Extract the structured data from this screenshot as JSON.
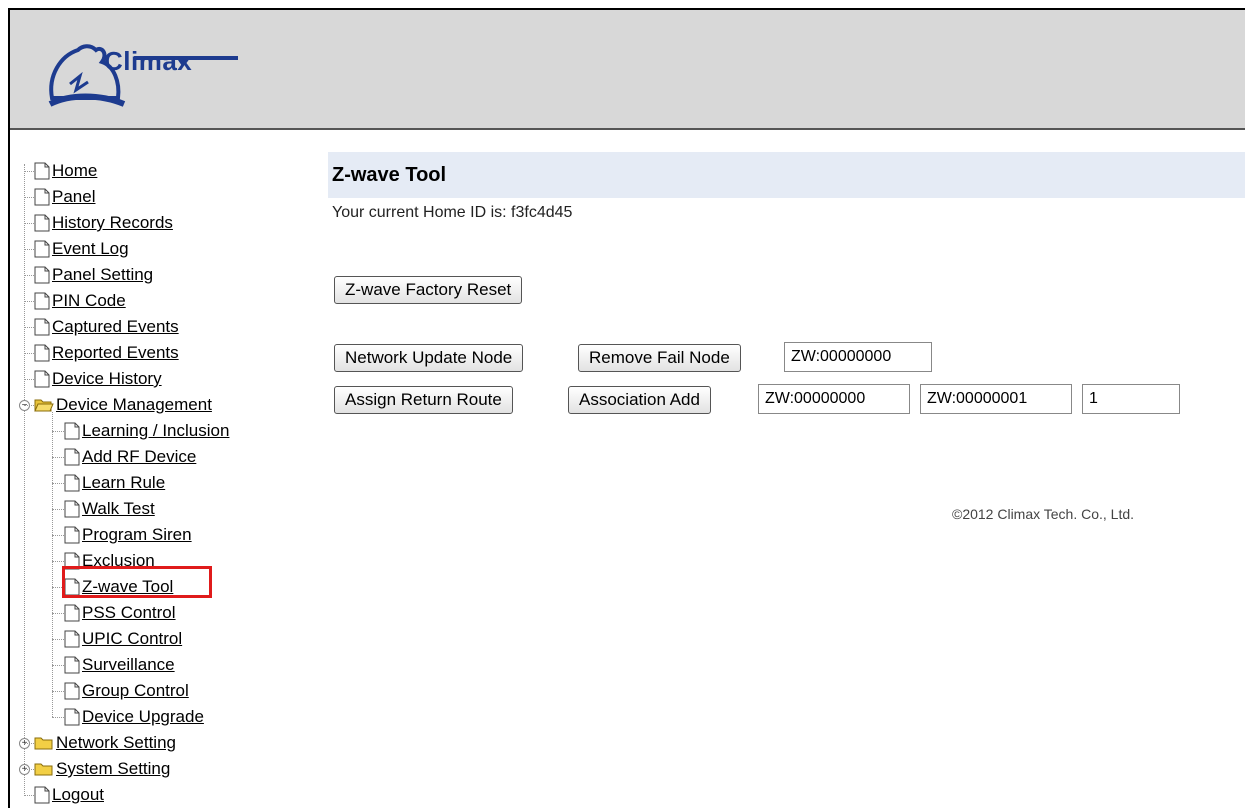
{
  "header": {
    "logo_text": "Climax"
  },
  "sidebar": {
    "items": [
      {
        "label": "Home"
      },
      {
        "label": "Panel"
      },
      {
        "label": "History Records"
      },
      {
        "label": "Event Log"
      },
      {
        "label": "Panel Setting"
      },
      {
        "label": "PIN Code"
      },
      {
        "label": "Captured Events"
      },
      {
        "label": "Reported Events"
      },
      {
        "label": "Device History"
      },
      {
        "label": "Device Management",
        "expanded": true,
        "children": [
          {
            "label": "Learning / Inclusion"
          },
          {
            "label": "Add RF Device"
          },
          {
            "label": "Learn Rule"
          },
          {
            "label": "Walk Test"
          },
          {
            "label": "Program Siren"
          },
          {
            "label": "Exclusion"
          },
          {
            "label": "Z-wave Tool",
            "selected": true
          },
          {
            "label": "PSS Control"
          },
          {
            "label": "UPIC Control"
          },
          {
            "label": "Surveillance"
          },
          {
            "label": "Group Control"
          },
          {
            "label": "Device Upgrade"
          }
        ]
      },
      {
        "label": "Network Setting",
        "expanded": false
      },
      {
        "label": "System Setting",
        "expanded": false
      },
      {
        "label": "Logout"
      }
    ],
    "highlight_color": "#e01b1b"
  },
  "main": {
    "title": "Z-wave Tool",
    "home_id_text": "Your current Home ID is: f3fc4d45",
    "factory_reset_label": "Z-wave Factory Reset",
    "network_update_label": "Network Update Node",
    "remove_fail_label": "Remove Fail Node",
    "remove_fail_node_value": "ZW:00000000",
    "assign_route_label": "Assign Return Route",
    "association_add_label": "Association Add",
    "association_src_value": "ZW:00000000",
    "association_dst_value": "ZW:00000001",
    "association_group_value": "1"
  },
  "footer": {
    "copyright": "©2012 Climax Tech. Co., Ltd."
  },
  "colors": {
    "header_bg": "#d8d8d8",
    "title_bar_bg": "#e5ebf5",
    "brand_blue": "#1d3b8f"
  }
}
